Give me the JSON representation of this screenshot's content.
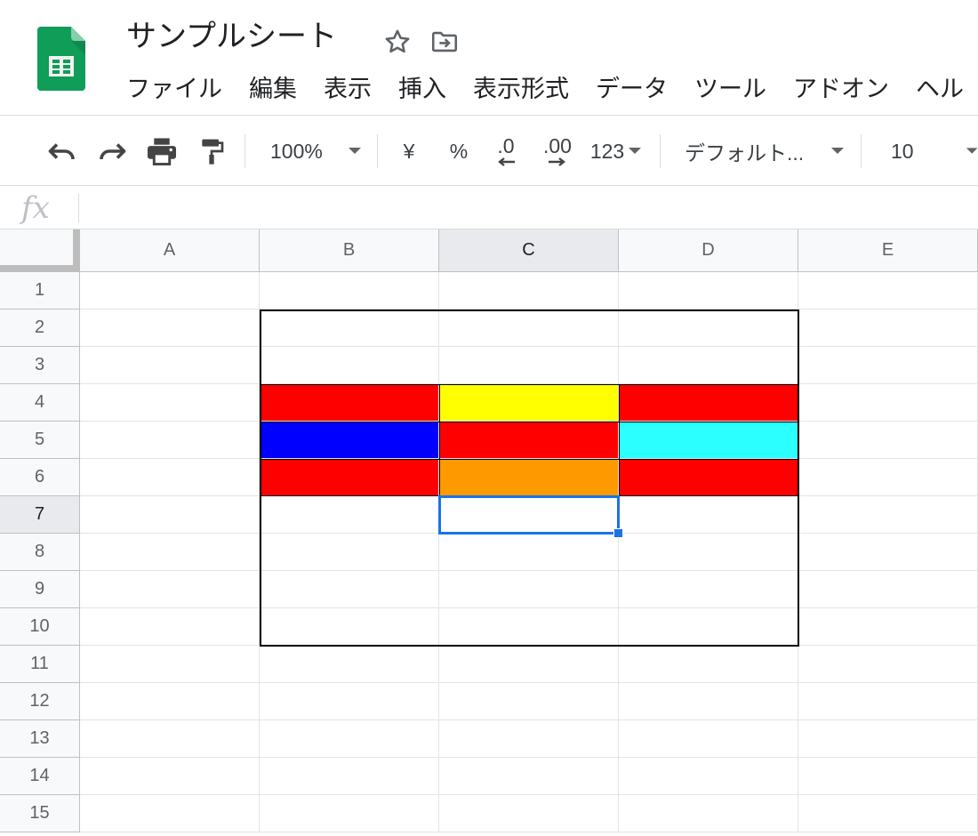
{
  "app": {
    "doc_title": "サンプルシート",
    "brand_color": "#0f9d58",
    "icons": [
      "sheets-logo-icon",
      "star-icon",
      "move-to-folder-icon"
    ]
  },
  "menu": [
    "ファイル",
    "編集",
    "表示",
    "挿入",
    "表示形式",
    "データ",
    "ツール",
    "アドオン",
    "ヘル"
  ],
  "toolbar": {
    "zoom": "100%",
    "currency": "¥",
    "percent": "%",
    "decrease_decimal": ".0",
    "increase_decimal": ".00",
    "more_formats": "123",
    "font": "デフォルト...",
    "font_size": "10",
    "icons": [
      "undo-icon",
      "redo-icon",
      "print-icon",
      "paint-format-icon",
      "dropdown-caret-icon"
    ]
  },
  "formula_bar": {
    "fx_label": "fx",
    "value": ""
  },
  "grid": {
    "columns": [
      "A",
      "B",
      "C",
      "D",
      "E"
    ],
    "rows": [
      "1",
      "2",
      "3",
      "4",
      "5",
      "6",
      "7",
      "8",
      "9",
      "10",
      "11",
      "12",
      "13",
      "14",
      "15"
    ],
    "active_cell": "C7",
    "fills": [
      {
        "cell": "B4",
        "color": "#ff0000"
      },
      {
        "cell": "C4",
        "color": "#ffff00"
      },
      {
        "cell": "D4",
        "color": "#ff0000"
      },
      {
        "cell": "B5",
        "color": "#0000ff"
      },
      {
        "cell": "C5",
        "color": "#ff0000"
      },
      {
        "cell": "D5",
        "color": "#2bffff"
      },
      {
        "cell": "B6",
        "color": "#ff0000"
      },
      {
        "cell": "C6",
        "color": "#ff9900"
      },
      {
        "cell": "D6",
        "color": "#ff0000"
      }
    ],
    "bordered_range": "B2:D10",
    "bordered_rows": [
      "4",
      "5",
      "6"
    ],
    "border_color": "#000000",
    "selection_color": "#1a73e8"
  }
}
